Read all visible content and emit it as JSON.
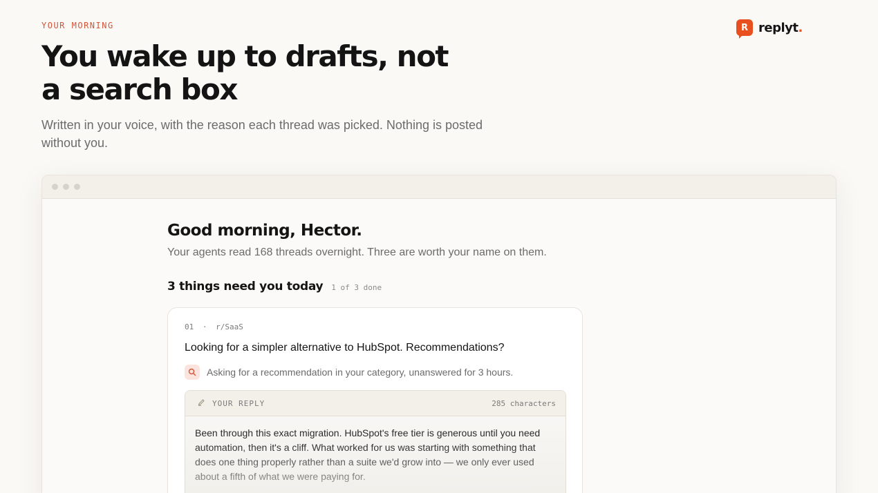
{
  "brand": {
    "logo_letter": "R",
    "name": "replyt",
    "dot": ".",
    "accent_color": "#e8501f"
  },
  "hero": {
    "eyebrow": "YOUR MORNING",
    "title": "You wake up to drafts, not a search box",
    "subtitle": "Written in your voice, with the reason each thread was picked. Nothing is posted without you."
  },
  "app": {
    "greeting": "Good morning, Hector.",
    "summary": "Your agents read 168 threads overnight. Three are worth your name on them.",
    "section_title": "3 things need you today",
    "progress": "1 of 3 done",
    "card": {
      "index": "01",
      "separator": "·",
      "community": "r/SaaS",
      "title": "Looking for a simpler alternative to HubSpot. Recommendations?",
      "reason_icon": "search-icon",
      "reason": "Asking for a recommendation in your category, unanswered for 3 hours.",
      "reply_icon": "pencil-icon",
      "reply_label": "YOUR REPLY",
      "reply_count": "285 characters",
      "reply_text": "Been through this exact migration. HubSpot's free tier is generous until you need automation, then it's a cliff. What worked for us was starting with something that does one thing properly rather than a suite we'd grow into — we only ever used about a fifth of what we were paying for."
    }
  }
}
